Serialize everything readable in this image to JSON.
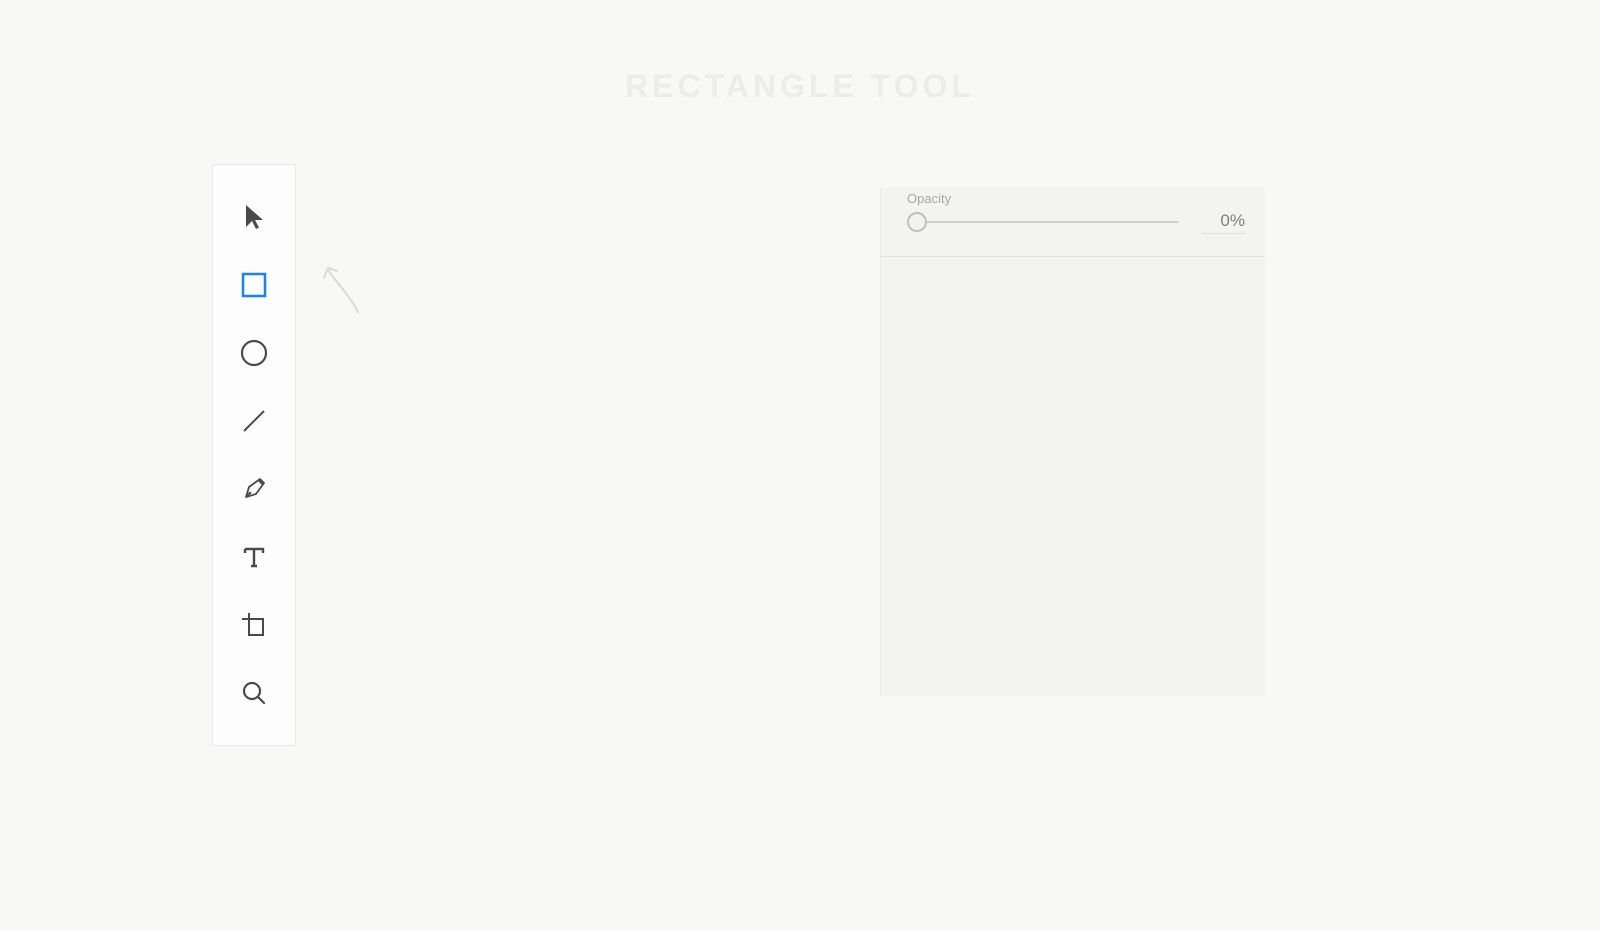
{
  "heading": "RECTANGLE TOOL",
  "toolbar": {
    "tools": [
      {
        "id": "select",
        "name": "select-tool",
        "active": false
      },
      {
        "id": "rectangle",
        "name": "rectangle-tool",
        "active": true
      },
      {
        "id": "ellipse",
        "name": "ellipse-tool",
        "active": false
      },
      {
        "id": "line",
        "name": "line-tool",
        "active": false
      },
      {
        "id": "pen",
        "name": "pen-tool",
        "active": false
      },
      {
        "id": "text",
        "name": "text-tool",
        "active": false
      },
      {
        "id": "artboard",
        "name": "artboard-tool",
        "active": false
      },
      {
        "id": "zoom",
        "name": "zoom-tool",
        "active": false
      }
    ]
  },
  "panel": {
    "opacity": {
      "label": "Opacity",
      "value_display": "0%",
      "value": 0
    }
  },
  "colors": {
    "icon_default": "#4a4a4a",
    "icon_active": "#1583ff"
  }
}
